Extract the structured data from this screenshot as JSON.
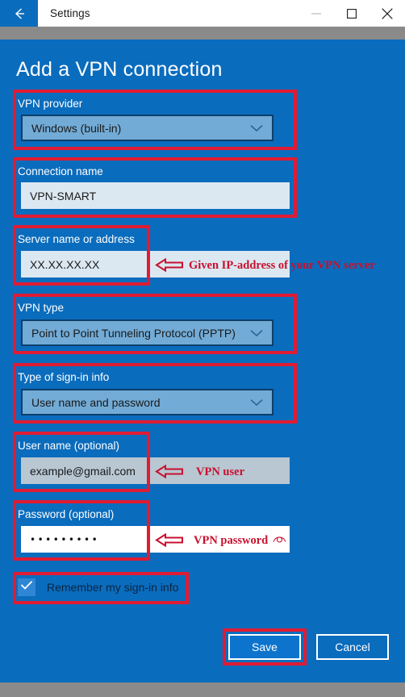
{
  "window": {
    "title": "Settings",
    "back_icon": "back-arrow-icon",
    "minimize_icon": "minimize-icon",
    "maximize_icon": "maximize-icon",
    "close_icon": "close-icon"
  },
  "page": {
    "title": "Add a VPN connection"
  },
  "fields": {
    "vpn_provider": {
      "label": "VPN provider",
      "value": "Windows (built-in)",
      "chevron_icon": "chevron-down-icon"
    },
    "connection_name": {
      "label": "Connection name",
      "value": "VPN-SMART",
      "placeholder": ""
    },
    "server_address": {
      "label": "Server name or address",
      "value": "XX.XX.XX.XX",
      "placeholder": ""
    },
    "vpn_type": {
      "label": "VPN type",
      "value": "Point to Point Tunneling Protocol (PPTP)",
      "chevron_icon": "chevron-down-icon"
    },
    "signin_type": {
      "label": "Type of sign-in info",
      "value": "User name and password",
      "chevron_icon": "chevron-down-icon"
    },
    "user_name": {
      "label": "User name (optional)",
      "value": "example@gmail.com",
      "placeholder": ""
    },
    "password": {
      "label": "Password (optional)",
      "value": "•••••••••",
      "placeholder": "",
      "reveal_icon": "eye-icon"
    }
  },
  "remember": {
    "label": "Remember my sign-in info",
    "checked": true,
    "check_icon": "checkmark-icon"
  },
  "buttons": {
    "save": "Save",
    "cancel": "Cancel"
  },
  "annotations": [
    {
      "text": "Given IP-address of your VPN server",
      "arrow_icon": "left-arrow-icon"
    },
    {
      "text": "VPN user",
      "arrow_icon": "left-arrow-icon"
    },
    {
      "text": "VPN password",
      "arrow_icon": "left-arrow-icon"
    }
  ],
  "colors": {
    "page_background": "#0a6cbd",
    "annotation_red": "#e01b33",
    "annotation_text": "#c8102e",
    "dropdown_fill": "#72abd6",
    "input_fill": "#dce8f1",
    "accent_button": "#0d74cd"
  }
}
